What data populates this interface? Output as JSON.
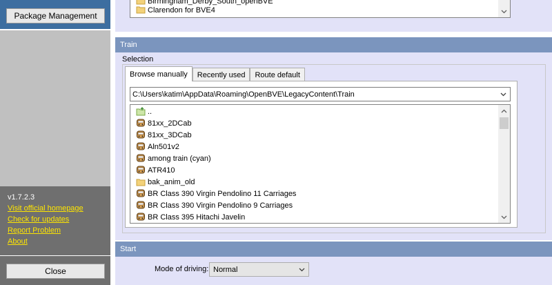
{
  "sidebar": {
    "package_button": "Package Management",
    "version": "v1.7.2.3",
    "links": [
      "Visit official homepage",
      "Check for updates",
      "Report Problem",
      "About"
    ],
    "close_button": "Close"
  },
  "route": {
    "items": [
      {
        "label": "Clarendon for BVE4",
        "icon": "folder-icon"
      }
    ]
  },
  "train": {
    "header": "Train",
    "selection_label": "Selection",
    "tabs": [
      "Browse manually",
      "Recently used",
      "Route default"
    ],
    "active_tab": "Browse manually",
    "path": "C:\\Users\\katim\\AppData\\Roaming\\OpenBVE\\LegacyContent\\Train",
    "items": [
      {
        "label": "..",
        "icon": "parent-folder-icon"
      },
      {
        "label": "81xx_2DCab",
        "icon": "train-icon"
      },
      {
        "label": "81xx_3DCab",
        "icon": "train-icon"
      },
      {
        "label": "Aln501v2",
        "icon": "train-icon"
      },
      {
        "label": "among train (cyan)",
        "icon": "train-icon"
      },
      {
        "label": "ATR410",
        "icon": "train-icon"
      },
      {
        "label": "bak_anim_old",
        "icon": "folder-icon"
      },
      {
        "label": "BR Class 390 Virgin Pendolino 11 Carriages",
        "icon": "train-icon"
      },
      {
        "label": "BR Class 390 Virgin Pendolino 9 Carriages",
        "icon": "train-icon"
      },
      {
        "label": "BR Class 395 Hitachi Javelin",
        "icon": "train-icon"
      }
    ]
  },
  "start": {
    "header": "Start",
    "mode_label": "Mode of driving:",
    "mode_value": "Normal"
  },
  "colors": {
    "sidebar_blue": "#3d6ea0",
    "section_header": "#7b95be",
    "panel_bg": "#e2e2f8",
    "link_yellow": "#ffe600"
  }
}
